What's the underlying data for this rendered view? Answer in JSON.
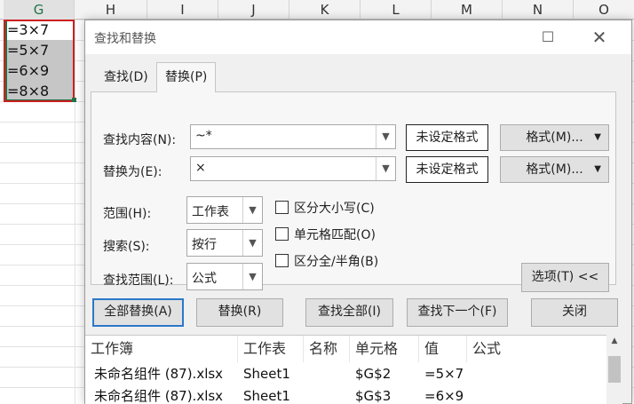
{
  "spreadsheet": {
    "columns": [
      "G",
      "H",
      "I",
      "J",
      "K",
      "L",
      "M",
      "N",
      "O"
    ],
    "cells": [
      "=3×7",
      "=5×7",
      "=6×9",
      "=8×8"
    ]
  },
  "dialog": {
    "title": "查找和替换",
    "tabs": [
      "查找(D)",
      "替换(P)"
    ],
    "find_what_label": "查找内容(N):",
    "find_what_value": "~*",
    "replace_with_label": "替换为(E):",
    "replace_with_value": "×",
    "no_format_label": "未设定格式",
    "format_button": "格式(M)...",
    "within_label": "范围(H):",
    "within_value": "工作表",
    "search_label": "搜索(S):",
    "search_value": "按行",
    "look_in_label": "查找范围(L):",
    "look_in_value": "公式",
    "match_case": "区分大小写(C)",
    "match_entire": "单元格匹配(O)",
    "match_width": "区分全/半角(B)",
    "options_button": "选项(T) <<",
    "replace_all": "全部替换(A)",
    "replace": "替换(R)",
    "find_all": "查找全部(I)",
    "find_next": "查找下一个(F)",
    "close": "关闭"
  },
  "results": {
    "headers": [
      "工作簿",
      "工作表",
      "名称",
      "单元格",
      "值",
      "公式"
    ],
    "rows": [
      [
        "未命名组件 (87).xlsx",
        "Sheet1",
        "",
        "$G$2",
        "=5×7",
        ""
      ],
      [
        "未命名组件 (87).xlsx",
        "Sheet1",
        "",
        "$G$3",
        "=6×9",
        ""
      ]
    ]
  },
  "icons": {
    "maximize": "maximize-icon",
    "close": "close-icon",
    "dropdown": "chevron-down-icon",
    "scroll_up": "scroll-up-icon"
  },
  "colors": {
    "selection_red": "#cc1f1f",
    "excel_green": "#217346",
    "primary_border": "#2c78c8"
  }
}
